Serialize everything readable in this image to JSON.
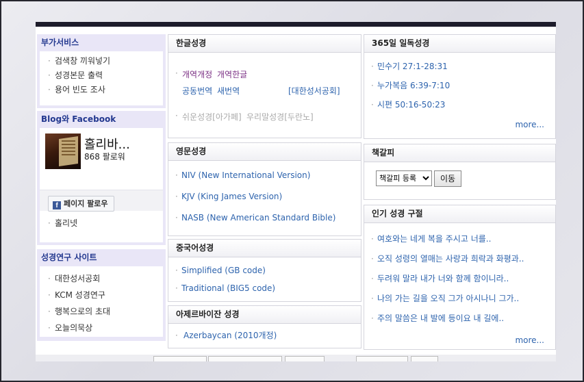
{
  "sidebar": {
    "extra_services": {
      "title": "부가서비스",
      "items": [
        "검색창 끼워넣기",
        "성경본문 출력",
        "용어 빈도 조사"
      ]
    },
    "blog_facebook": {
      "title": "Blog와 Facebook",
      "page_name": "홀리바...",
      "followers": "868 팔로워",
      "follow_label": "페이지 팔로우",
      "links": [
        "홀리넷"
      ]
    },
    "research_sites": {
      "title": "성경연구 사이트",
      "items": [
        "대한성서공회",
        "KCM 성경연구",
        "행복으로의 초대",
        "오늘의묵상"
      ]
    }
  },
  "korean_bible": {
    "title": "한글성경",
    "row1": [
      "개역개정",
      "개역한글"
    ],
    "row2": [
      "공동번역",
      "새번역"
    ],
    "publisher": "[대한성서공회]",
    "row3": [
      "쉬운성경[아가페]",
      "우리말성경[두란노]"
    ]
  },
  "english_bible": {
    "title": "영문성경",
    "items": [
      "NIV (New International Version)",
      "KJV (King James Version)",
      "NASB (New American Standard Bible)"
    ]
  },
  "chinese_bible": {
    "title": "중국어성경",
    "items": [
      "Simplified (GB code)",
      "Traditional (BIG5 code)"
    ]
  },
  "azerbaijani_bible": {
    "title": "아제르바이잔 성경",
    "items": [
      "Azerbaycan (2010개정)"
    ]
  },
  "daily_bible": {
    "title": "365일 일독성경",
    "items": [
      "민수기 27:1-28:31",
      "누가복음 6:39-7:10",
      "시편 50:16-50:23"
    ],
    "more": "more..."
  },
  "bookmark": {
    "title": "책갈피",
    "select_value": "책갈피 등록",
    "move_label": "이동"
  },
  "popular_verses": {
    "title": "인기 성경 구절",
    "items": [
      "여호와는 네게 복을 주시고 너를..",
      "오직 성령의 열매는 사랑과 희락과 화평과..",
      "두려워 말라 내가 너와 함께 함이니라..",
      "나의 가는 길을 오직 그가 아시나니 그가..",
      "주의 말씀은 내 발에 등이요 내 길에.."
    ],
    "more": "more..."
  },
  "colors": {
    "sidebar_bg": "#e9e6f7",
    "sidebar_title": "#23388f",
    "link": "#2d63ad",
    "visited": "#7a2e83",
    "top_bar": "#1d1c2b"
  }
}
